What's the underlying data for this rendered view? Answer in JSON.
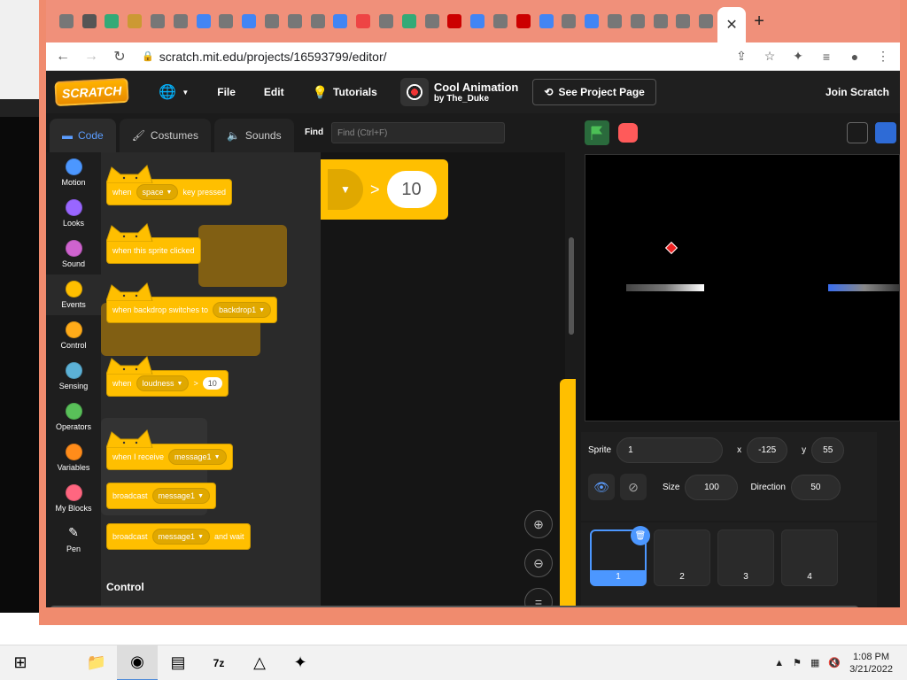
{
  "browser": {
    "url": "scratch.mit.edu/projects/16593799/editor/",
    "tabs": [
      "",
      "",
      "",
      "",
      "",
      "",
      "",
      "",
      "",
      "",
      "",
      "",
      "",
      "",
      "",
      "",
      "",
      "",
      "",
      "",
      "",
      "",
      "",
      "",
      "",
      "",
      "",
      "",
      ""
    ],
    "active_tab_close": "✕",
    "new_tab": "+"
  },
  "scratch": {
    "logo": "SCRATCH",
    "menu": {
      "file": "File",
      "edit": "Edit",
      "tutorials": "Tutorials"
    },
    "project": {
      "title": "Cool Animation",
      "author": "by The_Duke"
    },
    "see_project": "See Project Page",
    "join": "Join Scratch",
    "tabs": {
      "code": "Code",
      "costumes": "Costumes",
      "sounds": "Sounds"
    },
    "find_label": "Find",
    "find_placeholder": "Find (Ctrl+F)",
    "categories": [
      {
        "label": "Motion",
        "color": "#4c97ff"
      },
      {
        "label": "Looks",
        "color": "#9966ff"
      },
      {
        "label": "Sound",
        "color": "#cf63cf"
      },
      {
        "label": "Events",
        "color": "#ffbf00"
      },
      {
        "label": "Control",
        "color": "#ffab19"
      },
      {
        "label": "Sensing",
        "color": "#5cb1d6"
      },
      {
        "label": "Operators",
        "color": "#59c059"
      },
      {
        "label": "Variables",
        "color": "#ff8c1a"
      },
      {
        "label": "My Blocks",
        "color": "#ff6680"
      },
      {
        "label": "Pen",
        "color": "#0fbd8c"
      }
    ],
    "blocks": {
      "when_key": {
        "when": "when",
        "key": "space",
        "suffix": "key pressed"
      },
      "sprite_clicked": "when this sprite clicked",
      "backdrop": {
        "text": "when backdrop switches to",
        "value": "backdrop1"
      },
      "loudness": {
        "when": "when",
        "sensor": "loudness",
        "op": ">",
        "value": "10"
      },
      "receive": {
        "text": "when I receive",
        "value": "message1"
      },
      "broadcast": {
        "text": "broadcast",
        "value": "message1"
      },
      "broadcast_wait": {
        "text": "broadcast",
        "value": "message1",
        "suffix": "and wait"
      }
    },
    "control_label": "Control",
    "workspace_block": {
      "op": ">",
      "value": "10"
    },
    "sprite_info": {
      "sprite_label": "Sprite",
      "sprite_name": "1",
      "x_label": "x",
      "x": "-125",
      "y_label": "y",
      "y": "55",
      "size_label": "Size",
      "size": "100",
      "direction_label": "Direction",
      "direction": "50"
    },
    "sprites": [
      "1",
      "2",
      "3",
      "4"
    ]
  },
  "taskbar": {
    "time": "1:08 PM",
    "date": "3/21/2022"
  }
}
